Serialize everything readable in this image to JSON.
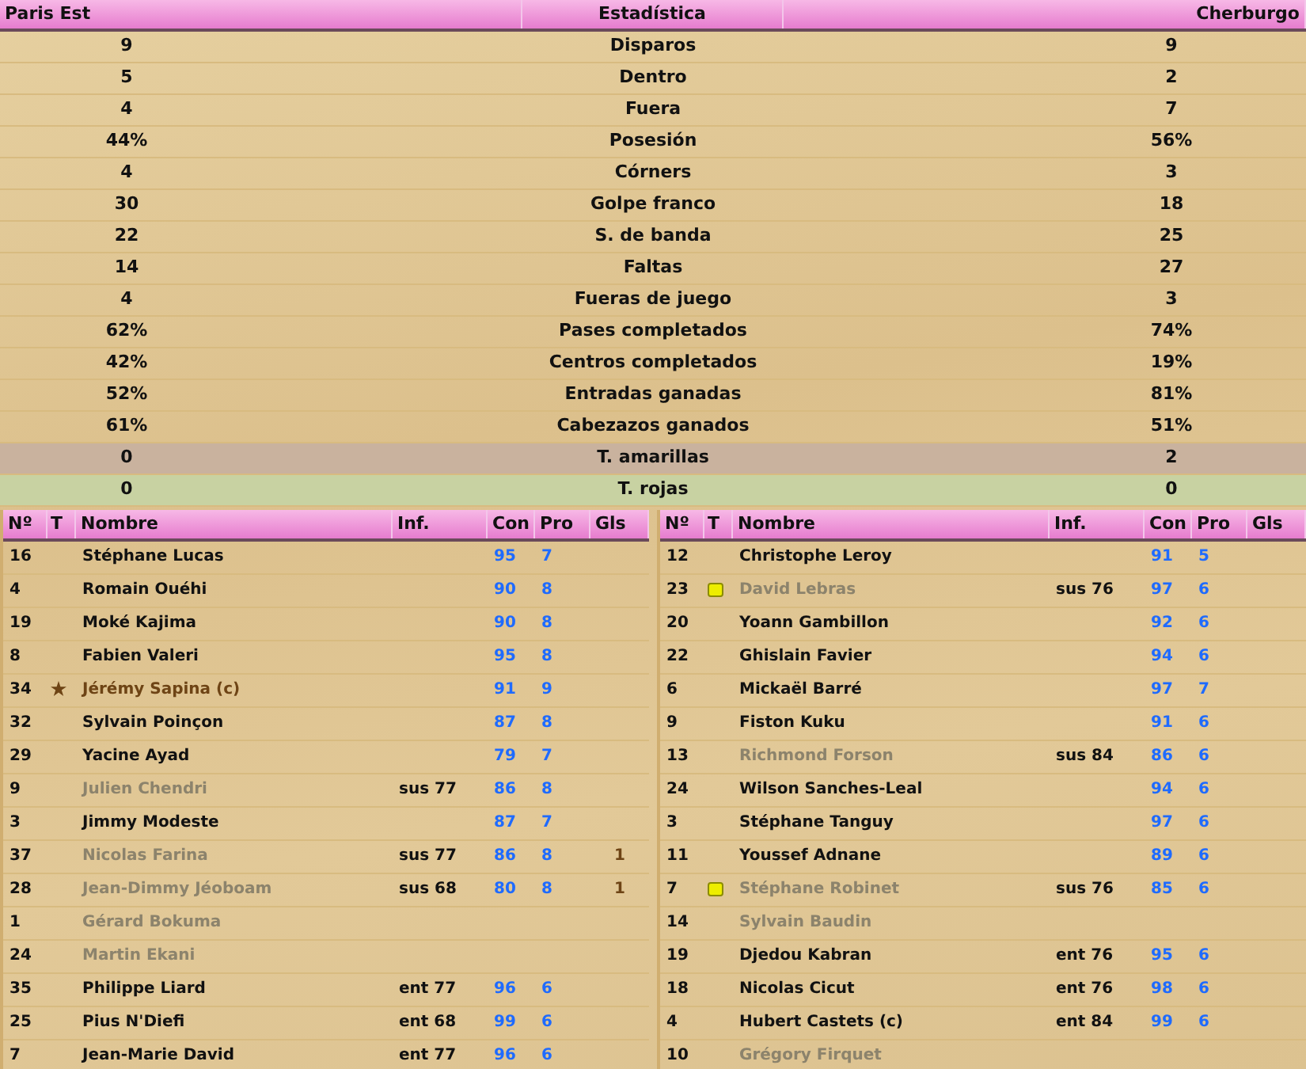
{
  "stats_header": {
    "home": "Paris Est",
    "title": "Estadística",
    "away": "Cherburgo"
  },
  "stats": [
    {
      "label": "Disparos",
      "home": "9",
      "away": "9",
      "kind": "plain"
    },
    {
      "label": "Dentro",
      "home": "5",
      "away": "2",
      "kind": "plain"
    },
    {
      "label": "Fuera",
      "home": "4",
      "away": "7",
      "kind": "plain"
    },
    {
      "label": "Posesión",
      "home": "44%",
      "away": "56%",
      "kind": "plain"
    },
    {
      "label": "Córners",
      "home": "4",
      "away": "3",
      "kind": "plain"
    },
    {
      "label": "Golpe franco",
      "home": "30",
      "away": "18",
      "kind": "plain"
    },
    {
      "label": "S. de banda",
      "home": "22",
      "away": "25",
      "kind": "plain"
    },
    {
      "label": "Faltas",
      "home": "14",
      "away": "27",
      "kind": "plain"
    },
    {
      "label": "Fueras de juego",
      "home": "4",
      "away": "3",
      "kind": "plain"
    },
    {
      "label": "Pases completados",
      "home": "62%",
      "away": "74%",
      "kind": "plain"
    },
    {
      "label": "Centros completados",
      "home": "42%",
      "away": "19%",
      "kind": "plain"
    },
    {
      "label": "Entradas ganadas",
      "home": "52%",
      "away": "81%",
      "kind": "plain"
    },
    {
      "label": "Cabezazos ganados",
      "home": "61%",
      "away": "51%",
      "kind": "plain"
    },
    {
      "label": "T. amarillas",
      "home": "0",
      "away": "2",
      "kind": "yellow"
    },
    {
      "label": "T. rojas",
      "home": "0",
      "away": "0",
      "kind": "red"
    }
  ],
  "lineups": [
    {
      "columns": [
        "Nº",
        "T",
        "Nombre",
        "Inf.",
        "Con",
        "Pro",
        "Gls"
      ],
      "players": [
        {
          "number": "16",
          "name": "Stéphane Lucas",
          "con": "95",
          "pro": "7",
          "dimmed": false
        },
        {
          "number": "4",
          "name": "Romain Ouéhi",
          "con": "90",
          "pro": "8",
          "dimmed": false
        },
        {
          "number": "19",
          "name": "Moké Kajima",
          "con": "90",
          "pro": "8",
          "dimmed": false
        },
        {
          "number": "8",
          "name": "Fabien Valeri",
          "con": "95",
          "pro": "8",
          "dimmed": false
        },
        {
          "number": "34",
          "name": "Jérémy Sapina (c)",
          "con": "91",
          "pro": "9",
          "dimmed": false,
          "starred": true
        },
        {
          "number": "32",
          "name": "Sylvain Poinçon",
          "con": "87",
          "pro": "8",
          "dimmed": false
        },
        {
          "number": "29",
          "name": "Yacine Ayad",
          "con": "79",
          "pro": "7",
          "dimmed": false
        },
        {
          "number": "9",
          "name": "Julien Chendri",
          "info": "sus 77",
          "con": "86",
          "pro": "8",
          "dimmed": true
        },
        {
          "number": "3",
          "name": "Jimmy Modeste",
          "con": "87",
          "pro": "7",
          "dimmed": false
        },
        {
          "number": "37",
          "name": "Nicolas Farina",
          "info": "sus 77",
          "con": "86",
          "pro": "8",
          "goals": "1",
          "dimmed": true
        },
        {
          "number": "28",
          "name": "Jean-Dimmy Jéoboam",
          "info": "sus 68",
          "con": "80",
          "pro": "8",
          "goals": "1",
          "dimmed": true
        },
        {
          "number": "1",
          "name": "Gérard Bokuma",
          "dimmed": true
        },
        {
          "number": "24",
          "name": "Martin Ekani",
          "dimmed": true
        },
        {
          "number": "35",
          "name": "Philippe Liard",
          "info": "ent 77",
          "con": "96",
          "pro": "6",
          "dimmed": false
        },
        {
          "number": "25",
          "name": "Pius N'Diefi",
          "info": "ent 68",
          "con": "99",
          "pro": "6",
          "dimmed": false
        },
        {
          "number": "7",
          "name": "Jean-Marie David",
          "info": "ent 77",
          "con": "96",
          "pro": "6",
          "dimmed": false
        }
      ]
    },
    {
      "columns": [
        "Nº",
        "T",
        "Nombre",
        "Inf.",
        "Con",
        "Pro",
        "Gls"
      ],
      "players": [
        {
          "number": "12",
          "name": "Christophe Leroy",
          "con": "91",
          "pro": "5",
          "dimmed": false
        },
        {
          "number": "23",
          "name": "David Lebras",
          "info": "sus 76",
          "con": "97",
          "pro": "6",
          "dimmed": true,
          "booked": true
        },
        {
          "number": "20",
          "name": "Yoann Gambillon",
          "con": "92",
          "pro": "6",
          "dimmed": false
        },
        {
          "number": "22",
          "name": "Ghislain Favier",
          "con": "94",
          "pro": "6",
          "dimmed": false
        },
        {
          "number": "6",
          "name": "Mickaël Barré",
          "con": "97",
          "pro": "7",
          "dimmed": false
        },
        {
          "number": "9",
          "name": "Fiston Kuku",
          "con": "91",
          "pro": "6",
          "dimmed": false
        },
        {
          "number": "13",
          "name": "Richmond Forson",
          "info": "sus 84",
          "con": "86",
          "pro": "6",
          "dimmed": true
        },
        {
          "number": "24",
          "name": "Wilson Sanches-Leal",
          "con": "94",
          "pro": "6",
          "dimmed": false
        },
        {
          "number": "3",
          "name": "Stéphane Tanguy",
          "con": "97",
          "pro": "6",
          "dimmed": false
        },
        {
          "number": "11",
          "name": "Youssef Adnane",
          "con": "89",
          "pro": "6",
          "dimmed": false
        },
        {
          "number": "7",
          "name": "Stéphane Robinet",
          "info": "sus 76",
          "con": "85",
          "pro": "6",
          "dimmed": true,
          "booked": true
        },
        {
          "number": "14",
          "name": "Sylvain Baudin",
          "dimmed": true
        },
        {
          "number": "19",
          "name": "Djedou Kabran",
          "info": "ent 76",
          "con": "95",
          "pro": "6",
          "dimmed": false
        },
        {
          "number": "18",
          "name": "Nicolas Cicut",
          "info": "ent 76",
          "con": "98",
          "pro": "6",
          "dimmed": false
        },
        {
          "number": "4",
          "name": "Hubert Castets (c)",
          "info": "ent 84",
          "con": "99",
          "pro": "6",
          "dimmed": false
        },
        {
          "number": "10",
          "name": "Grégory Firquet",
          "dimmed": true
        }
      ]
    }
  ]
}
